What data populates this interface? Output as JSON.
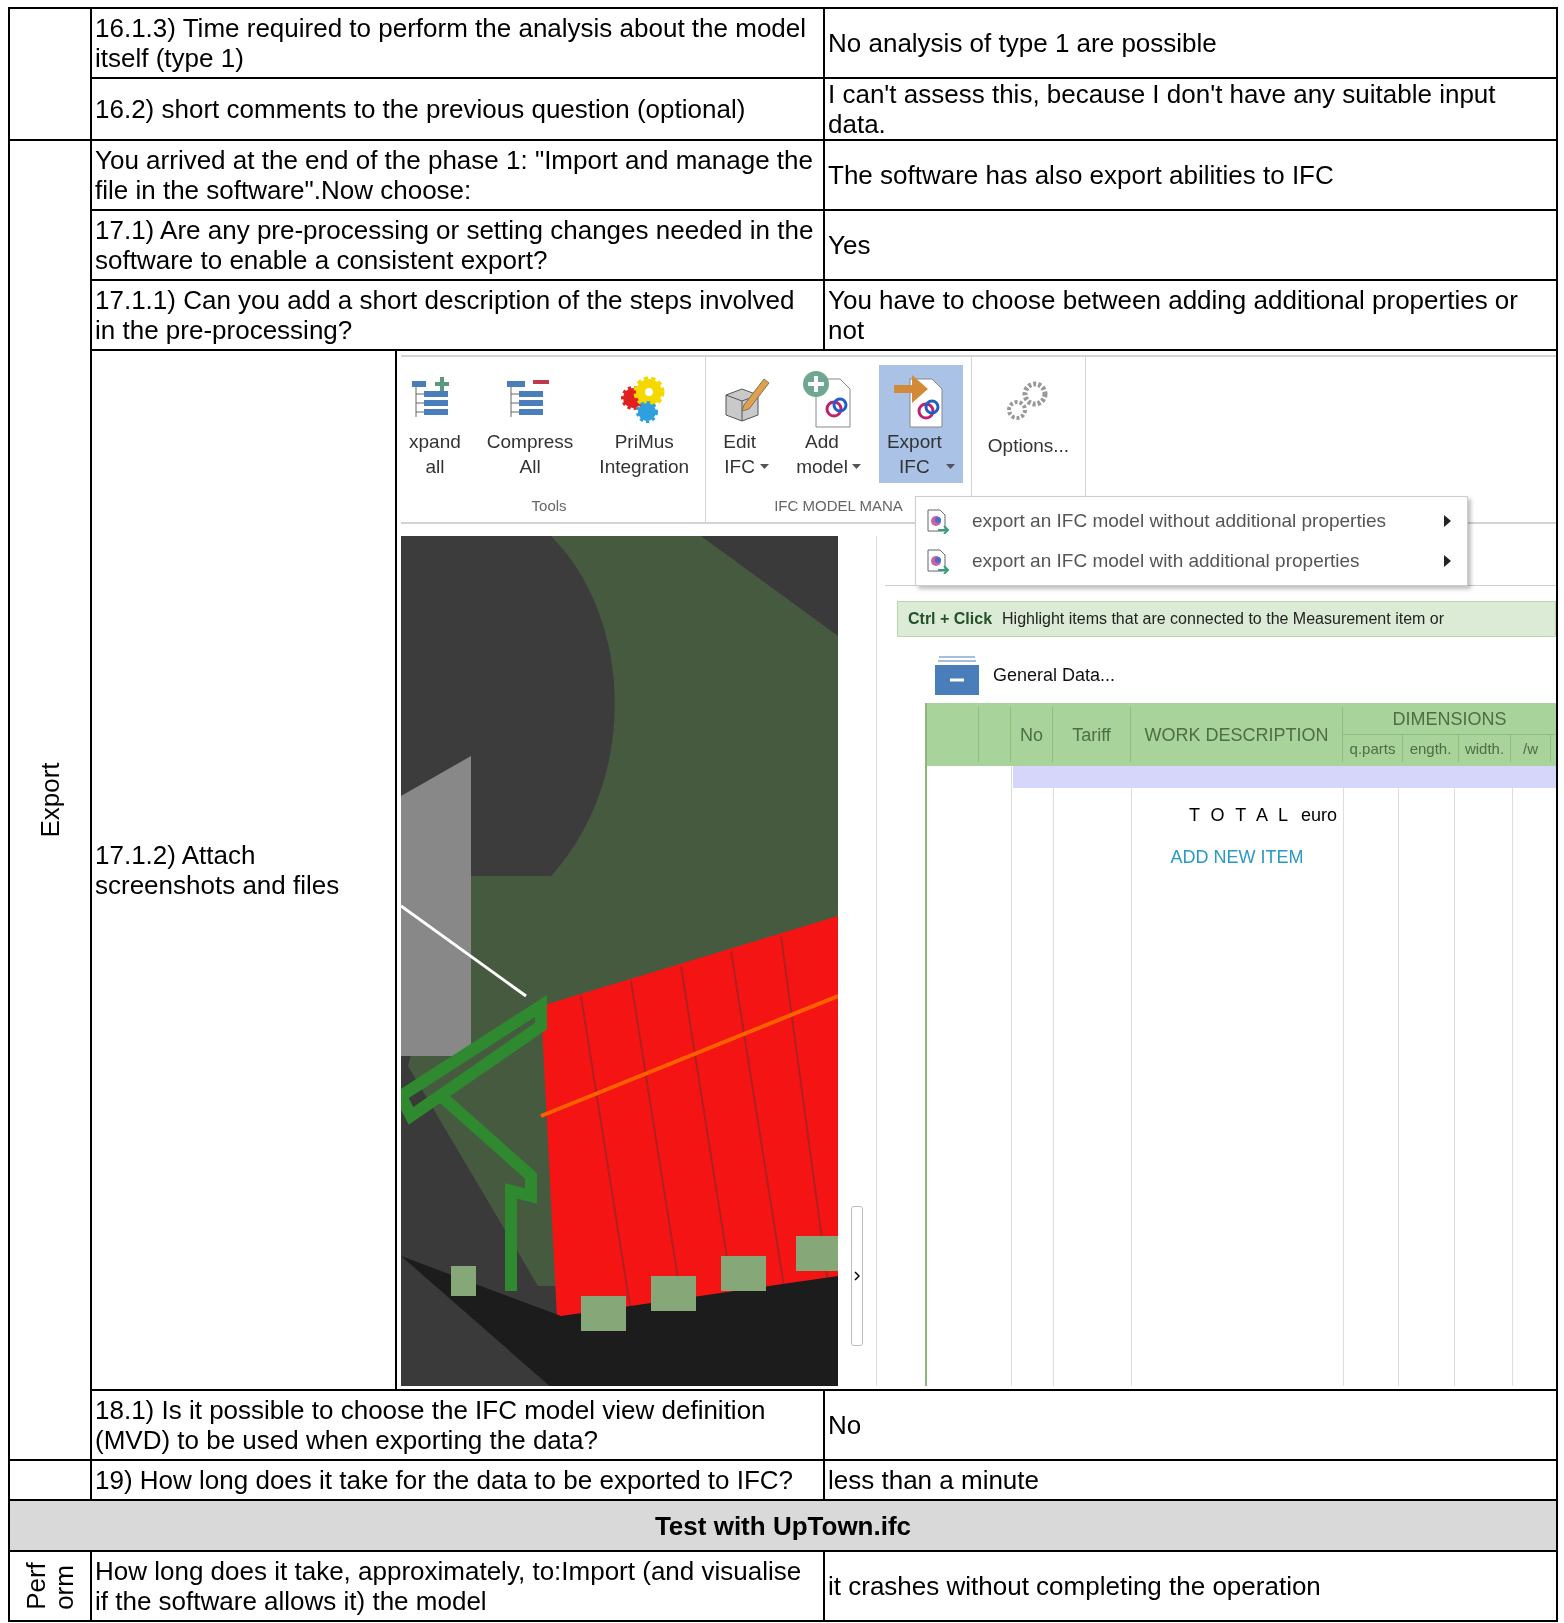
{
  "blocks": [
    {
      "kind": "section",
      "rows": [
        {
          "kind": "text",
          "question": "16.1.3) Time required to perform the analysis about the model itself (type 1)",
          "answer": "No analysis of type 1 are possible"
        },
        {
          "kind": "text",
          "question": "16.2) short comments to the previous question (optional)",
          "answer": "I can't assess this, because I don't have any suitable input data."
        }
      ]
    },
    {
      "kind": "section",
      "label": [
        "Export"
      ],
      "rows": [
        {
          "kind": "text",
          "question": "You arrived at the end of the phase 1: \"Import and manage the file in the software\".Now choose:",
          "answer": "The software has also export abilities to IFC"
        },
        {
          "kind": "text",
          "question": "17.1) Are any pre-processing or setting changes needed in the software to enable a consistent export?",
          "answer": "Yes"
        },
        {
          "kind": "text",
          "question": "17.1.1) Can you add a short description of the steps involved in the pre-processing?",
          "answer": "You have to choose between adding additional properties or not"
        },
        {
          "kind": "screenshot",
          "question": "17.1.2) Attach screenshots and files"
        },
        {
          "kind": "text",
          "question": "18.1) Is it possible to choose the IFC model view definition (MVD) to be used when exporting the data?",
          "answer": "No"
        }
      ]
    },
    {
      "kind": "section",
      "rows": [
        {
          "kind": "text",
          "question": "19) How long does it take for the data to be exported to IFC?",
          "answer": "less than a minute"
        }
      ]
    },
    {
      "kind": "banner",
      "title": "Test with UpTown.ifc"
    },
    {
      "kind": "section",
      "label": [
        "Perf",
        "orm"
      ],
      "rows": [
        {
          "kind": "text",
          "question": "How long does it take, approximately, to:Import (and visualise if the software allows it) the model",
          "answer": "it crashes without completing the operation"
        }
      ]
    }
  ],
  "screenshot": {
    "ribbon": {
      "groups": [
        {
          "label": "Tools",
          "buttons": [
            {
              "kind": "expand",
              "label": "xpand all",
              "dropdown": false,
              "selected": false
            },
            {
              "kind": "compress",
              "label": "Compress All",
              "dropdown": false,
              "selected": false
            },
            {
              "kind": "gears",
              "label": "PriMus Integration",
              "dropdown": false,
              "selected": false
            }
          ]
        },
        {
          "label": "IFC MODEL MANA",
          "buttons": [
            {
              "kind": "edit",
              "label": "Edit IFC",
              "dropdown": true,
              "selected": false
            },
            {
              "kind": "add",
              "label": "Add model",
              "dropdown": true,
              "selected": false
            },
            {
              "kind": "export",
              "label": "Export IFC",
              "dropdown": true,
              "selected": true
            }
          ]
        },
        {
          "buttons": [
            {
              "kind": "options",
              "label": "Options...",
              "dropdown": false,
              "selected": false
            }
          ]
        }
      ]
    },
    "menu": [
      {
        "label": "export an IFC model without additional properties",
        "submenu": true
      },
      {
        "label": "export an IFC model with additional properties",
        "submenu": true
      }
    ],
    "hint": {
      "shortcut": "Ctrl + Click",
      "text": "Highlight items that are connected to the Measurement item or"
    },
    "section_title": "General Data...",
    "table": {
      "columns": [
        "No",
        "Tariff",
        "WORK DESCRIPTION"
      ],
      "group": "DIMENSIONS",
      "subcolumns": [
        "q.parts",
        "ength.",
        "width.",
        "/w"
      ],
      "total_label": "T O T A L",
      "total_unit": "euro",
      "add_link": "ADD NEW ITEM"
    }
  }
}
